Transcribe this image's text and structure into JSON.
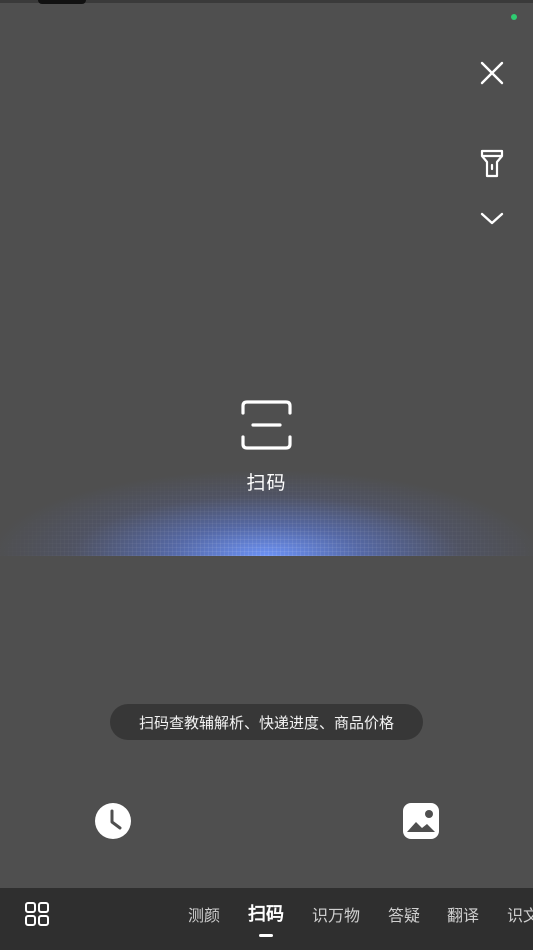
{
  "scan": {
    "label": "扫码"
  },
  "hint": {
    "text": "扫码查教辅解析、快递进度、商品价格"
  },
  "tabs": [
    {
      "label": "测颜"
    },
    {
      "label": "扫码"
    },
    {
      "label": "识万物"
    },
    {
      "label": "答疑"
    },
    {
      "label": "翻译"
    },
    {
      "label": "识文"
    }
  ],
  "icons": {
    "close": "close-icon",
    "torch": "flashlight-icon",
    "collapse": "chevron-down-icon",
    "scan": "scan-frame-icon",
    "history": "clock-icon",
    "album": "image-icon",
    "grid": "grid-icon"
  },
  "colors": {
    "background": "#4f4f4f",
    "bottom_bar": "#2f2f2f",
    "glow": "#6e96ff",
    "status_dot": "#2ecc71"
  }
}
